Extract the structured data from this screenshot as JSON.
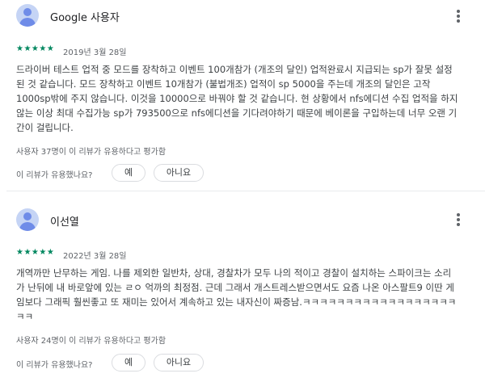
{
  "reviews": [
    {
      "author": "Google 사용자",
      "stars": "★★★★★",
      "date": "2019년 3월 28일",
      "lines": [
        "드라이버 테스트 업적 중 모드를 장착하고 이벤트 100개참가 (개조의 달인) 업적완료시 지급되는 sp가 잘못 설정",
        "된 것 같습니다. 모드 장착하고 이벤트 10개참가 (불법개조) 업적이 sp 5000을 주는데 개조의 달인은 고작",
        "1000sp밖에 주지 않습니다. 이것을 10000으로 바꿔야 할 것 같습니다. 현 상황에서 nfs에디션 수집 업적을 하지",
        "않는 이상 최대 수집가능 sp가 793500으로 nfs에디션을 기다려야하기 때문에 베이론을 구입하는데 너무 오랜 기",
        "간이 걸립니다."
      ],
      "helpful": "사용자 37명이 이 리뷰가 유용하다고 평가함",
      "ask": "이 리뷰가 유용했나요?",
      "yes": "예",
      "no": "아니요"
    },
    {
      "author": "이선열",
      "stars": "★★★★★",
      "date": "2022년 3월 28일",
      "lines": [
        "개역까만 난무하는 게임. 나를 제외한 일반차, 상대, 경찰차가 모두 나의 적이고 경찰이 설치하는 스파이크는 소리",
        "가 난뒤에 내 바로앞에 있는 ㄹㅇ 억까의 최정점. 근데 그래서 개스트레스받으면서도 요즘 나온 아스팔트9 이딴 게",
        "임보다 그래픽 훨씬좋고 또 재미는 있어서 계속하고 있는 내자신이 짜증남.ㅋㅋㅋㅋㅋㅋㅋㅋㅋㅋㅋㅋㅋㅋㅋㅋㅋㅋ",
        "ㅋㅋ"
      ],
      "helpful": "사용자 24명이 이 리뷰가 유용하다고 평가함",
      "ask": "이 리뷰가 유용했나요?",
      "yes": "예",
      "no": "아니요"
    }
  ],
  "icons": {
    "avatar": "person-avatar-icon",
    "more": "more-vert-icon"
  },
  "colors": {
    "star": "#01875f",
    "avatar_bg": "#c5d4f5",
    "avatar_fg": "#6f8ce8"
  }
}
